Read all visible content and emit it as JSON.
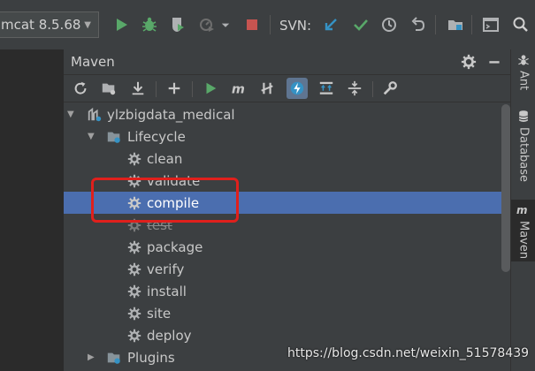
{
  "toolbar": {
    "run_config": "mcat 8.5.68",
    "svn_label": "SVN:"
  },
  "maven_panel": {
    "title": "Maven"
  },
  "tree": {
    "project": "ylzbigdata_medical",
    "lifecycle": "Lifecycle",
    "goals": [
      "clean",
      "validate",
      "compile",
      "test",
      "package",
      "verify",
      "install",
      "site",
      "deploy"
    ],
    "selected": "compile",
    "plugins": "Plugins"
  },
  "right_tabs": {
    "ant": "Ant",
    "database": "Database",
    "maven": "Maven"
  },
  "watermark": "https://blog.csdn.net/weixin_51578439",
  "colors": {
    "selection": "#4b6eaf",
    "highlight_box": "#e0201c",
    "run_green": "#59a869",
    "stop_red": "#c75450",
    "accent_blue": "#3592c4"
  },
  "icons": [
    "run-icon",
    "debug-icon",
    "coverage-icon",
    "profile-icon",
    "stop-icon",
    "svn-update-icon",
    "svn-commit-icon",
    "history-icon",
    "revert-icon",
    "project-structure-icon",
    "terminal-icon",
    "search-icon",
    "gear-icon",
    "minimize-icon",
    "reload-icon",
    "generate-sources-icon",
    "download-icon",
    "add-icon",
    "run-maven-icon",
    "execute-goal-icon",
    "skip-tests-icon",
    "offline-icon",
    "show-dependencies-icon",
    "collapse-all-icon",
    "settings-wrench-icon"
  ]
}
